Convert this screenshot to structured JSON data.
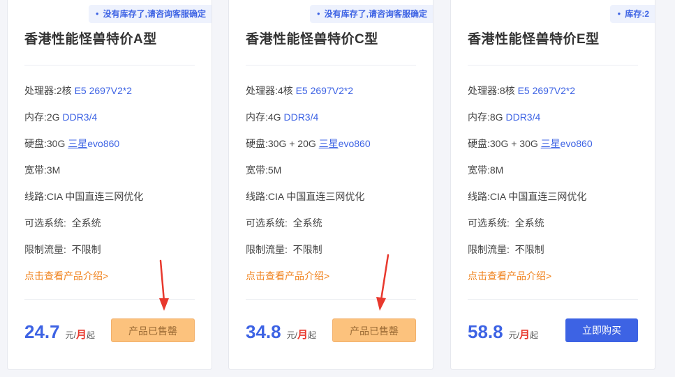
{
  "cards": [
    {
      "stock_note": "没有库存了,请咨询客服确定",
      "title": "香港性能怪兽特价A型",
      "cpu_label": "处理器:",
      "cpu_cores": "2核",
      "cpu_model": "E5 2697V2*2",
      "ram_label": "内存:",
      "ram_size": "2G",
      "ram_type": "DDR3/4",
      "disk_label": "硬盘:",
      "disk_size": "30G",
      "disk_brand": "三星",
      "disk_model": "evo860",
      "bw_label": "宽带:",
      "bw_value": "3M",
      "line_label": "线路:",
      "line_value": "CIA 中国直连三网优化",
      "os_label": "可选系统:",
      "os_value": "全系统",
      "traffic_label": "限制流量:",
      "traffic_value": "不限制",
      "intro_link": "点击查看产品介绍>",
      "price": "24.7",
      "unit_prefix": "元/",
      "unit_month": "月",
      "unit_suffix": "起",
      "button": "产品已售罄"
    },
    {
      "stock_note": "没有库存了,请咨询客服确定",
      "title": "香港性能怪兽特价C型",
      "cpu_label": "处理器:",
      "cpu_cores": "4核",
      "cpu_model": "E5 2697V2*2",
      "ram_label": "内存:",
      "ram_size": "4G",
      "ram_type": "DDR3/4",
      "disk_label": "硬盘:",
      "disk_size": "30G + 20G",
      "disk_brand": "三星",
      "disk_model": "evo860",
      "bw_label": "宽带:",
      "bw_value": "5M",
      "line_label": "线路:",
      "line_value": "CIA 中国直连三网优化",
      "os_label": "可选系统:",
      "os_value": "全系统",
      "traffic_label": "限制流量:",
      "traffic_value": "不限制",
      "intro_link": "点击查看产品介绍>",
      "price": "34.8",
      "unit_prefix": "元/",
      "unit_month": "月",
      "unit_suffix": "起",
      "button": "产品已售罄"
    },
    {
      "stock_note": "库存:2",
      "title": "香港性能怪兽特价E型",
      "cpu_label": "处理器:",
      "cpu_cores": "8核",
      "cpu_model": "E5 2697V2*2",
      "ram_label": "内存:",
      "ram_size": "8G",
      "ram_type": "DDR3/4",
      "disk_label": "硬盘:",
      "disk_size": "30G + 30G",
      "disk_brand": "三星",
      "disk_model": "evo860",
      "bw_label": "宽带:",
      "bw_value": "8M",
      "line_label": "线路:",
      "line_value": "CIA 中国直连三网优化",
      "os_label": "可选系统:",
      "os_value": "全系统",
      "traffic_label": "限制流量:",
      "traffic_value": "不限制",
      "intro_link": "点击查看产品介绍>",
      "price": "58.8",
      "unit_prefix": "元/",
      "unit_month": "月",
      "unit_suffix": "起",
      "button": "立即购买"
    }
  ],
  "colors": {
    "accent": "#3d63e4",
    "link_orange": "#f0831e",
    "soldout_button": "#fcc27d",
    "month_red": "#e8382d",
    "arrow_red": "#e8382d"
  }
}
